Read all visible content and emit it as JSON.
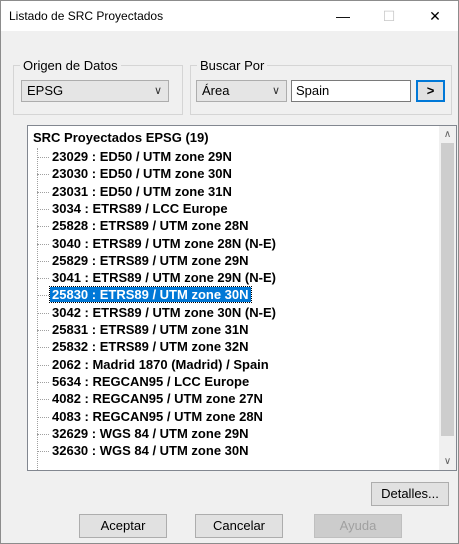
{
  "window": {
    "title": "Listado de SRC Proyectados",
    "minimize_glyph": "—",
    "maximize_glyph": "☐",
    "close_glyph": "✕"
  },
  "origen": {
    "legend": "Origen de Datos",
    "selected": "EPSG"
  },
  "buscar": {
    "legend": "Buscar Por",
    "field_selected": "Área",
    "query": "Spain",
    "go_label": ">"
  },
  "tree": {
    "root_label": "SRC Proyectados EPSG (19)",
    "items": [
      "23029 : ED50 / UTM zone 29N",
      "23030 : ED50 / UTM zone 30N",
      "23031 : ED50 / UTM zone 31N",
      "3034 : ETRS89 / LCC Europe",
      "25828 : ETRS89 / UTM zone 28N",
      "3040 : ETRS89 / UTM zone 28N (N-E)",
      "25829 : ETRS89 / UTM zone 29N",
      "3041 : ETRS89 / UTM zone 29N (N-E)",
      "25830 : ETRS89 / UTM zone 30N",
      "3042 : ETRS89 / UTM zone 30N (N-E)",
      "25831 : ETRS89 / UTM zone 31N",
      "25832 : ETRS89 / UTM zone 32N",
      "2062 : Madrid 1870 (Madrid) / Spain",
      "5634 : REGCAN95 / LCC Europe",
      "4082 : REGCAN95 / UTM zone 27N",
      "4083 : REGCAN95 / UTM zone 28N",
      "32629 : WGS 84 / UTM zone 29N",
      "32630 : WGS 84 / UTM zone 30N"
    ],
    "selected_index": 8
  },
  "icons": {
    "chevron": "chevron-down-icon",
    "scroll_up": "scroll-up-icon",
    "scroll_down": "scroll-down-icon"
  },
  "buttons": {
    "detalles": "Detalles...",
    "aceptar": "Aceptar",
    "cancelar": "Cancelar",
    "ayuda": "Ayuda"
  },
  "colors": {
    "selection": "#0078d7",
    "focus_border": "#0078d7"
  }
}
